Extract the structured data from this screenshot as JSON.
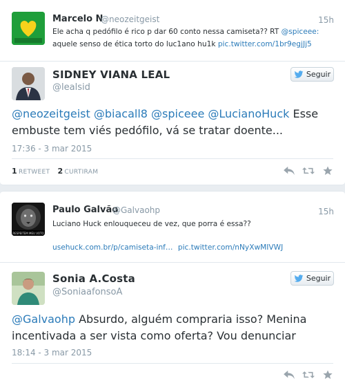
{
  "tweet1": {
    "name": "Marcelo N",
    "handle": "@neozeitgeist",
    "time": "15h",
    "line1": "Ele acha q pedófilo é rico p dar 60 conto nessa camiseta?? RT ",
    "line1_link": "@spiceee:",
    "line2": "aquele senso de ética torto do luc1ano hu1k ",
    "line2_link": "pic.twitter.com/1br9egjJj5"
  },
  "reply1": {
    "name": "SIDNEY VIANA LEAL",
    "handle": "@lealsid",
    "follow_label": "Seguir",
    "mentions": "@neozeitgeist @biacall8 @spiceee @LucianoHuck",
    "text_tail": " Esse",
    "line2": "embuste tem viés pedófilo, vá se tratar doente...",
    "timestamp": "17:36 - 3 mar 2015",
    "retweets_count": "1",
    "retweets_label": "RETWEET",
    "likes_count": "2",
    "likes_label": "CURTIRAM"
  },
  "tweet2": {
    "name": "Paulo Galvão",
    "handle": "@Galvaohp",
    "time": "15h",
    "line1": "Luciano Huck enlouqueceu de vez, que porra é essa??",
    "link1": "usehuck.com.br/p/camiseta-inf…",
    "link2": "pic.twitter.com/nNyXwMIVWJ",
    "avatar_caption": "RESPEITEM MEU VOTO"
  },
  "reply2": {
    "name": "Sonia A.Costa",
    "handle": "@SoniaafonsoA",
    "follow_label": "Seguir",
    "mention": "@Galvaohp",
    "text_tail": " Absurdo, alguém compraria isso? Menina",
    "line2": "incentivada a ser vista como oferta? Vou denunciar",
    "timestamp": "18:14 - 3 mar 2015"
  },
  "icons": [
    "reply-icon",
    "retweet-icon",
    "favorite-icon",
    "twitter-bird-icon"
  ],
  "colors": {
    "link": "#2b7bb9",
    "muted": "#8899a6",
    "text": "#292f33",
    "background": "#e9edf1"
  }
}
